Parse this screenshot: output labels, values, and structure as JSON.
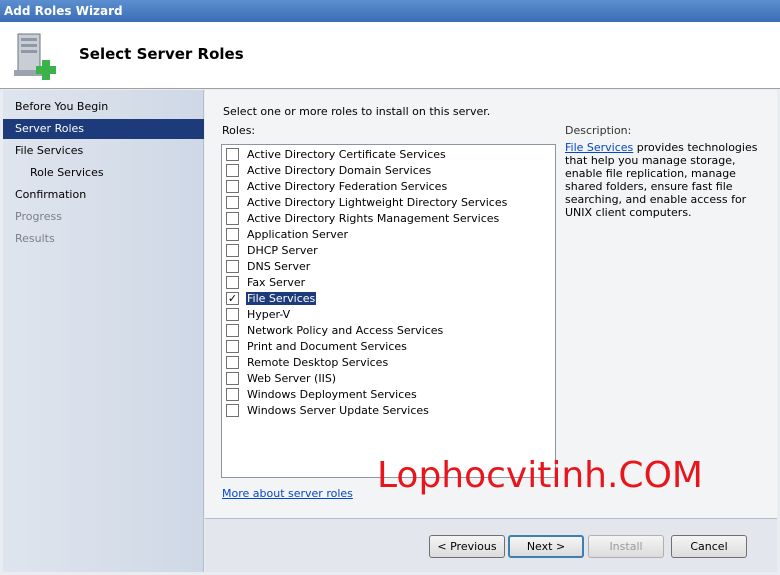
{
  "window": {
    "title": "Add Roles Wizard"
  },
  "header": {
    "title": "Select Server Roles",
    "icon": "server-add-icon"
  },
  "nav": {
    "items": [
      {
        "label": "Before You Begin",
        "state": "normal"
      },
      {
        "label": "Server Roles",
        "state": "active"
      },
      {
        "label": "File Services",
        "state": "normal"
      },
      {
        "label": "Role Services",
        "state": "sub"
      },
      {
        "label": "Confirmation",
        "state": "normal"
      },
      {
        "label": "Progress",
        "state": "disabled"
      },
      {
        "label": "Results",
        "state": "disabled"
      }
    ]
  },
  "main": {
    "instruction": "Select one or more roles to install on this server.",
    "roles_label": "Roles:",
    "roles": [
      {
        "label": "Active Directory Certificate Services",
        "checked": false
      },
      {
        "label": "Active Directory Domain Services",
        "checked": false
      },
      {
        "label": "Active Directory Federation Services",
        "checked": false
      },
      {
        "label": "Active Directory Lightweight Directory Services",
        "checked": false
      },
      {
        "label": "Active Directory Rights Management Services",
        "checked": false
      },
      {
        "label": "Application Server",
        "checked": false
      },
      {
        "label": "DHCP Server",
        "checked": false
      },
      {
        "label": "DNS Server",
        "checked": false
      },
      {
        "label": "Fax Server",
        "checked": false
      },
      {
        "label": "File Services",
        "checked": true,
        "selected": true
      },
      {
        "label": "Hyper-V",
        "checked": false
      },
      {
        "label": "Network Policy and Access Services",
        "checked": false
      },
      {
        "label": "Print and Document Services",
        "checked": false
      },
      {
        "label": "Remote Desktop Services",
        "checked": false
      },
      {
        "label": "Web Server (IIS)",
        "checked": false
      },
      {
        "label": "Windows Deployment Services",
        "checked": false
      },
      {
        "label": "Windows Server Update Services",
        "checked": false
      }
    ],
    "description_title": "Description:",
    "description_link": "File Services",
    "description_text": " provides technologies that help you manage storage, enable file replication, manage shared folders, ensure fast file searching, and enable access for UNIX client computers.",
    "more_link": "More about server roles",
    "watermark": "Lophocvitinh.COM"
  },
  "footer": {
    "previous": "< Previous",
    "next": "Next >",
    "install": "Install",
    "cancel": "Cancel"
  },
  "colors": {
    "accent": "#1d3b7a",
    "link": "#0645c8",
    "watermark": "#e8161c"
  }
}
